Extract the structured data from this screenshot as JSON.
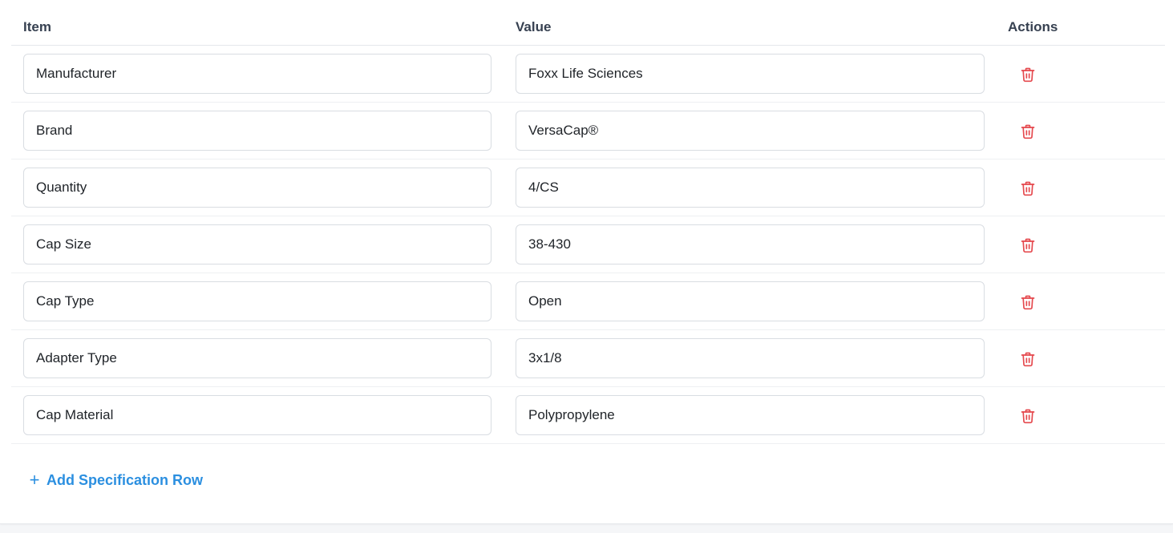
{
  "table": {
    "headers": {
      "item": "Item",
      "value": "Value",
      "actions": "Actions"
    },
    "rows": [
      {
        "item": "Manufacturer",
        "value": "Foxx Life Sciences"
      },
      {
        "item": "Brand",
        "value": "VersaCap®"
      },
      {
        "item": "Quantity",
        "value": "4/CS"
      },
      {
        "item": "Cap Size",
        "value": "38-430"
      },
      {
        "item": "Cap Type",
        "value": "Open"
      },
      {
        "item": "Adapter Type",
        "value": "3x1/8"
      },
      {
        "item": "Cap Material",
        "value": "Polypropylene"
      }
    ],
    "delete_icon": "trash-icon"
  },
  "add_row": {
    "icon": "plus-icon",
    "label": "Add Specification Row"
  },
  "colors": {
    "accent": "#2b8fe0",
    "danger": "#e5484d",
    "header_text": "#374151"
  }
}
